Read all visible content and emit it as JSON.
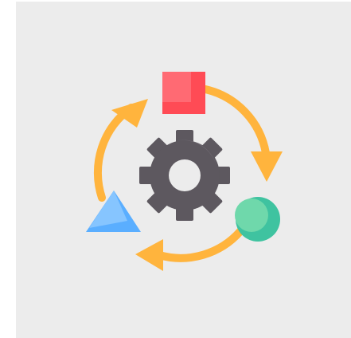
{
  "illustration": {
    "subject": "workflow-cycle",
    "icons": [
      "gear-icon",
      "square-icon",
      "circle-icon",
      "triangle-icon",
      "cycle-arrows-icon"
    ],
    "colors": {
      "background": "#ececec",
      "arrows": "#ffb43d",
      "gear": "#5d585f",
      "gear_highlight": "#6e6870",
      "square": "#ff4b55",
      "square_highlight": "#ff6a73",
      "circle": "#3fc3a0",
      "circle_highlight": "#6fd8ab",
      "triangle": "#5aaeff",
      "triangle_highlight": "#86c5ff"
    }
  }
}
